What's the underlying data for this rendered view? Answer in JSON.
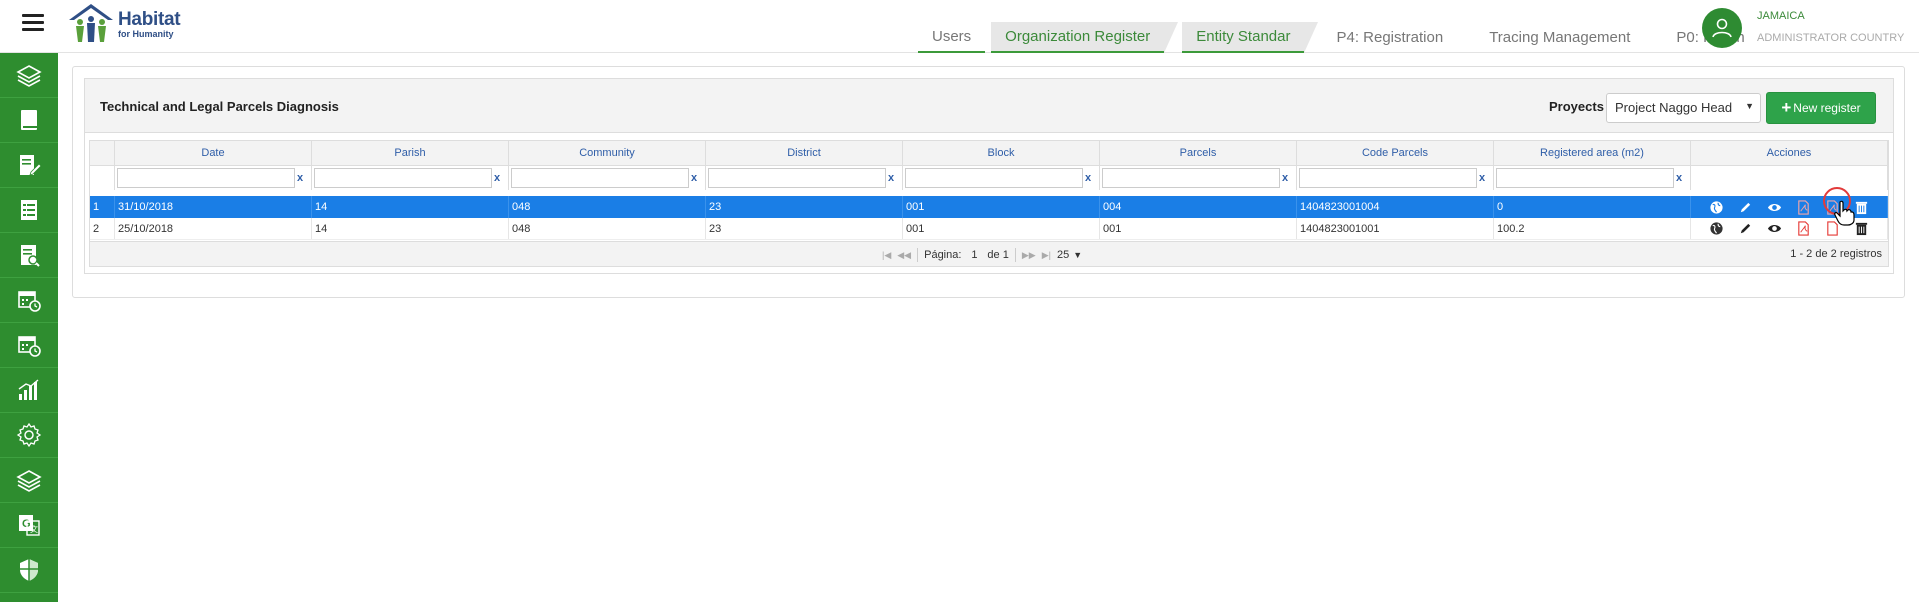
{
  "app": {
    "logo_line1": "Habitat",
    "logo_line2": "for Humanity"
  },
  "tabs": [
    {
      "label": "Users",
      "active": false
    },
    {
      "label": "Organization Register",
      "active": true
    },
    {
      "label": "Entity Standar",
      "active": true
    },
    {
      "label": "P4: Registration",
      "active": false
    },
    {
      "label": "Tracing Management",
      "active": false
    },
    {
      "label": "P0: Planin",
      "active": false
    }
  ],
  "user": {
    "country": "JAMAICA",
    "role": "ADMINISTRATOR COUNTRY"
  },
  "sidebar": {
    "icons": [
      "layers-icon",
      "book-icon",
      "edit-document-icon",
      "checklist-icon",
      "search-document-icon",
      "calendar-clock-icon",
      "calendar-clock-icon",
      "bar-chart-icon",
      "gear-icon",
      "layers-icon",
      "translate-icon",
      "shield-icon"
    ]
  },
  "panel": {
    "title": "Technical and Legal Parcels Diagnosis",
    "project_label": "Proyects",
    "project_value": "Project Naggo Head",
    "new_button": "New register"
  },
  "grid": {
    "columns": [
      "Date",
      "Parish",
      "Community",
      "District",
      "Block",
      "Parcels",
      "Code Parcels",
      "Registered area (m2)",
      "Acciones"
    ],
    "filter_clear": "x",
    "rows": [
      {
        "num": "1",
        "cells": [
          "31/10/2018",
          "14",
          "048",
          "23",
          "001",
          "004",
          "1404823001004",
          "0"
        ]
      },
      {
        "num": "2",
        "cells": [
          "25/10/2018",
          "14",
          "048",
          "23",
          "001",
          "001",
          "1404823001001",
          "100.2"
        ]
      }
    ],
    "pager": {
      "page_label": "Página:",
      "page": "1",
      "of_label": "de 1",
      "page_size": "25",
      "summary": "1 - 2 de 2 registros"
    }
  },
  "colors": {
    "brand_green": "#2e8d2f",
    "selection_blue": "#1a7ee6",
    "header_text_blue": "#2f5ea8",
    "new_button_green": "#2ea34a"
  }
}
